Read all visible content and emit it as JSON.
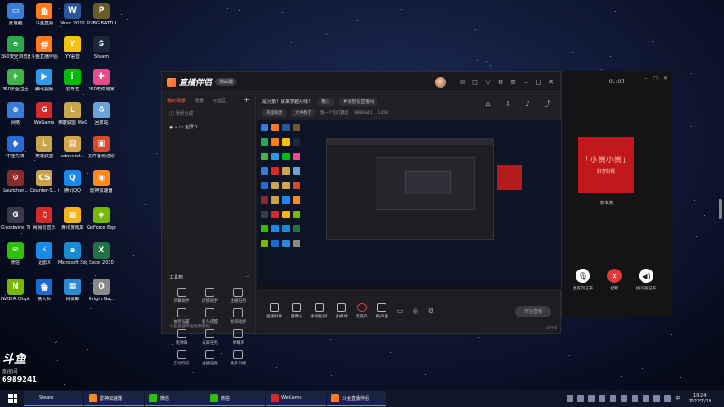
{
  "desktop": {
    "icons": [
      {
        "label": "此电脑",
        "color": "#3a7bd5",
        "glyph": "▭"
      },
      {
        "label": "斗鱼直播",
        "color": "#ff7a1a",
        "glyph": "鱼"
      },
      {
        "label": "Word 2010",
        "color": "#2a5699",
        "glyph": "W"
      },
      {
        "label": "PUBG BATTLEGR...",
        "color": "#6b5a2a",
        "glyph": "P"
      },
      {
        "label": "360安全浏览器",
        "color": "#2aa84a",
        "glyph": "e"
      },
      {
        "label": "斗鱼直播伴侣",
        "color": "#ff7a1a",
        "glyph": "伴"
      },
      {
        "label": "YY语音",
        "color": "#f4c20d",
        "glyph": "Y"
      },
      {
        "label": "Steam",
        "color": "#1b2838",
        "glyph": "S"
      },
      {
        "label": "360安全卫士",
        "color": "#3fb549",
        "glyph": "+"
      },
      {
        "label": "腾讯视频",
        "color": "#2f9be8",
        "glyph": "▶"
      },
      {
        "label": "爱奇艺",
        "color": "#00be06",
        "glyph": "i"
      },
      {
        "label": "360软件管家",
        "color": "#e84a8a",
        "glyph": "✚"
      },
      {
        "label": "网络",
        "color": "#3a7bd5",
        "glyph": "⊕"
      },
      {
        "label": "WeGame",
        "color": "#d42a2a",
        "glyph": "G"
      },
      {
        "label": "英雄联盟 WeGame版",
        "color": "#c9a64a",
        "glyph": "L"
      },
      {
        "label": "回收站",
        "color": "#6aa3d8",
        "glyph": "♻"
      },
      {
        "label": "中望先锋",
        "color": "#2a6ad4",
        "glyph": "◆"
      },
      {
        "label": "英雄联盟",
        "color": "#c9a64a",
        "glyph": "L"
      },
      {
        "label": "Administ...",
        "color": "#d4a84a",
        "glyph": "▤"
      },
      {
        "label": "文件备份还原",
        "color": "#d44a2a",
        "glyph": "▣"
      },
      {
        "label": "Launcher...",
        "color": "#8a2a2a",
        "glyph": "⚙"
      },
      {
        "label": "Counter-S... Global Off...",
        "color": "#c9a24a",
        "glyph": "CS"
      },
      {
        "label": "腾讯QQ",
        "color": "#1a8ae8",
        "glyph": "Q"
      },
      {
        "label": "雷神加速器",
        "color": "#ff8a1a",
        "glyph": "◉"
      },
      {
        "label": "Ghostwire: Tokyo",
        "color": "#3a3a4a",
        "glyph": "G"
      },
      {
        "label": "网易云音乐",
        "color": "#d42a2a",
        "glyph": "♫"
      },
      {
        "label": "腾讯游戏库",
        "color": "#f4b41a",
        "glyph": "▦"
      },
      {
        "label": "GeForce Experience",
        "color": "#76b900",
        "glyph": "◈"
      },
      {
        "label": "微信",
        "color": "#2dc100",
        "glyph": "✉"
      },
      {
        "label": "迅雷X",
        "color": "#1a8ae8",
        "glyph": "⚡"
      },
      {
        "label": "Microsoft Edge",
        "color": "#1a8ad4",
        "glyph": "e"
      },
      {
        "label": "Excel 2010",
        "color": "#207245",
        "glyph": "X"
      },
      {
        "label": "NVIDIA Display...",
        "color": "#76b900",
        "glyph": "N"
      },
      {
        "label": "鲁大师",
        "color": "#1a6ad4",
        "glyph": "鲁"
      },
      {
        "label": "网易邮",
        "color": "#2a8ad4",
        "glyph": "▦"
      },
      {
        "label": "Origin.Ga...",
        "color": "#8a8a8a",
        "glyph": "O"
      }
    ]
  },
  "app": {
    "name": "直播伴侣",
    "version": "测试版",
    "left_tabs": [
      "我的场景",
      "场景",
      "可选区"
    ],
    "scenes": [
      "场景合成",
      "全屏 1"
    ],
    "tools_title": "工具箱",
    "tools": [
      "弹幕助手",
      "房管助手",
      "主播任务",
      "抽奖设置",
      "新人提醒",
      "榜单助手",
      "观弹幕",
      "录屏任务",
      "弹幕库",
      "互动玩法",
      "主播任务",
      "更多功能"
    ],
    "left_bottom": "斗鱼直播伴侣使用教程",
    "info": {
      "title": "是兄弟！就来穿越火线！",
      "tag1": "格斗",
      "tag2": "#我想看直播间",
      "category": "英雄联盟",
      "tag3": "大神教学",
      "room_label": "我一个包打赢您",
      "room_id": "6989241",
      "fans": "1453"
    },
    "bottom": [
      "直播屏幕",
      "摄像头",
      "手机投屏",
      "多媒体",
      "麦克风",
      "扬声器"
    ],
    "start_button": "开始直播",
    "bottom_right": "40FPS"
  },
  "call": {
    "timer": "01:07",
    "avatar_text": "「小贵小贵」",
    "avatar_sub": "好梦好眠",
    "name": "袁玮杰",
    "actions": [
      "麦克风已开",
      "挂断",
      "扬声器已开"
    ]
  },
  "overlay": {
    "big": "斗鱼",
    "sub": "房间号",
    "num": "6989241"
  },
  "taskbar": {
    "items": [
      {
        "label": "Steam",
        "color": "#1b2838"
      },
      {
        "label": "雷神加速器",
        "color": "#ff8a1a"
      },
      {
        "label": "微信",
        "color": "#2dc100"
      },
      {
        "label": "微信",
        "color": "#2dc100"
      },
      {
        "label": "WeGame",
        "color": "#d42a2a"
      },
      {
        "label": "斗鱼直播伴侣",
        "color": "#ff7a1a"
      }
    ],
    "lang": "中",
    "time": "19:24",
    "date": "2022/7/19"
  }
}
